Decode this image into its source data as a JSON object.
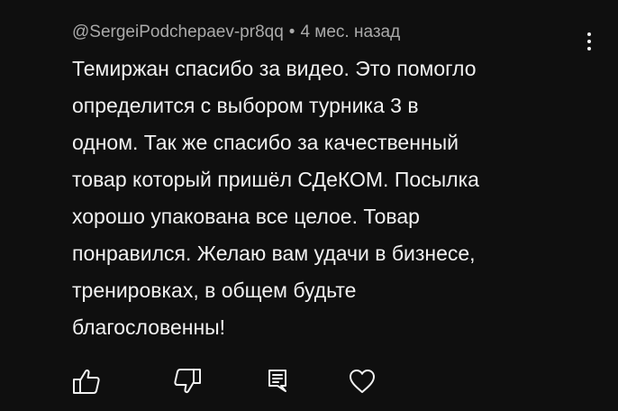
{
  "comment": {
    "author": "@SergeiPodchepaev-pr8qq",
    "separator": "•",
    "time": "4 мес. назад",
    "text_lines": [
      "Темиржан спасибо за видео. Это помогло",
      "определится с выбором турника 3 в",
      "одном. Так же спасибо за качественный",
      "товар который пришёл СДеКОМ. Посылка",
      "хорошо упакована все целое. Товар",
      "понравился. Желаю вам удачи в бизнесе,",
      "тренировках, в общем будьте",
      "благословенны!"
    ]
  },
  "icons": {
    "more": "more-vertical-icon",
    "like": "thumb-up-icon",
    "dislike": "thumb-down-icon",
    "reply": "reply-comment-icon",
    "heart": "heart-icon"
  },
  "colors": {
    "background": "#0f0f0f",
    "text": "#f1f1f1",
    "meta": "#aaaaaa"
  }
}
